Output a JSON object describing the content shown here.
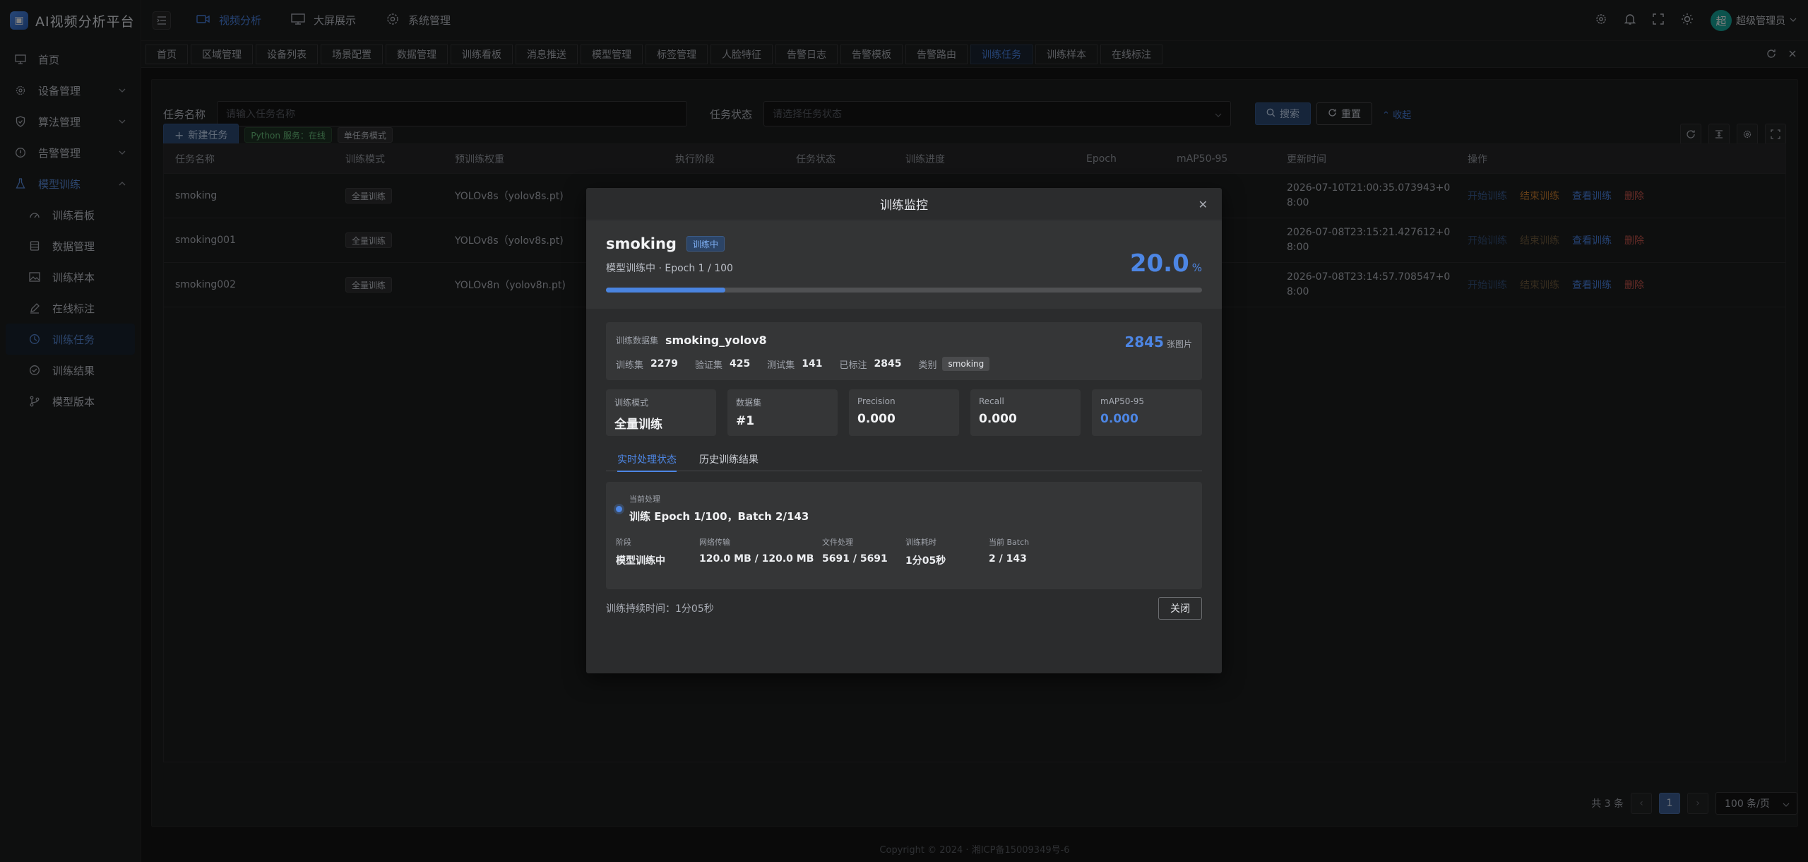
{
  "app": {
    "title": "AI视频分析平台",
    "logo_letter": "AI"
  },
  "sidebar": {
    "items": [
      {
        "label": "首页",
        "icon": "monitor-icon"
      },
      {
        "label": "设备管理",
        "icon": "gear-icon"
      },
      {
        "label": "算法管理",
        "icon": "shield-icon"
      },
      {
        "label": "告警管理",
        "icon": "alert-icon"
      },
      {
        "label": "模型训练",
        "icon": "flask-icon"
      }
    ],
    "subitems": [
      {
        "label": "训练看板",
        "icon": "dashboard-icon"
      },
      {
        "label": "数据管理",
        "icon": "database-icon"
      },
      {
        "label": "训练样本",
        "icon": "image-icon"
      },
      {
        "label": "在线标注",
        "icon": "edit-icon"
      },
      {
        "label": "训练任务",
        "icon": "clock-icon"
      },
      {
        "label": "训练结果",
        "icon": "check-circle-icon"
      },
      {
        "label": "模型版本",
        "icon": "branch-icon"
      }
    ]
  },
  "header": {
    "nav": [
      {
        "label": "视频分析",
        "icon": "camera-icon"
      },
      {
        "label": "大屏展示",
        "icon": "monitor-icon"
      },
      {
        "label": "系统管理",
        "icon": "gear-icon"
      }
    ],
    "user": {
      "avatar": "超",
      "name": "超级管理员"
    }
  },
  "tags": [
    "首页",
    "区域管理",
    "设备列表",
    "场景配置",
    "数据管理",
    "训练看板",
    "消息推送",
    "模型管理",
    "标签管理",
    "人脸特征",
    "告警日志",
    "告警模板",
    "告警路由",
    "训练任务",
    "训练样本",
    "在线标注"
  ],
  "search": {
    "task_name_label": "任务名称",
    "task_name_placeholder": "请输入任务名称",
    "task_status_label": "任务状态",
    "task_status_placeholder": "请选择任务状态",
    "search_btn": "搜索",
    "reset_btn": "重置",
    "collapse": "收起"
  },
  "toolbar": {
    "new_task": "新建任务",
    "python_status": "Python 服务：在线",
    "single_mode": "单任务模式"
  },
  "table": {
    "headers": [
      "任务名称",
      "训练模式",
      "预训练权重",
      "执行阶段",
      "任务状态",
      "训练进度",
      "Epoch",
      "mAP50-95",
      "更新时间",
      "操作"
    ],
    "rows": [
      {
        "name": "smoking",
        "mode": "全量训练",
        "weight": "YOLOv8s（yolov8s.pt)",
        "time1": "2026-07-10T21:00:35.073943+0",
        "time2": "8:00",
        "ops": [
          "开始训练",
          "结束训练",
          "查看训练",
          "删除"
        ]
      },
      {
        "name": "smoking001",
        "mode": "全量训练",
        "weight": "YOLOv8s（yolov8s.pt)",
        "time1": "2026-07-08T23:15:21.427612+0",
        "time2": "8:00",
        "ops": [
          "开始训练",
          "结束训练",
          "查看训练",
          "删除"
        ]
      },
      {
        "name": "smoking002",
        "mode": "全量训练",
        "weight": "YOLOv8n（yolov8n.pt)",
        "time1": "2026-07-08T23:14:57.708547+0",
        "time2": "8:00",
        "ops": [
          "开始训练",
          "结束训练",
          "查看训练",
          "删除"
        ]
      }
    ]
  },
  "pager": {
    "total": "共 3 条",
    "current": "1",
    "size": "100 条/页"
  },
  "footer": "Copyright © 2024 · 湘ICP备15009349号-6",
  "dialog": {
    "title": "训练监控",
    "task_name": "smoking",
    "status": "训练中",
    "subtitle": "模型训练中 · Epoch 1 / 100",
    "percent": "20.0",
    "percent_unit": "%",
    "progress": 0.2,
    "dataset": {
      "label": "训练数据集",
      "name": "smoking_yolov8",
      "count": "2845",
      "count_unit": "张图片",
      "train_label": "训练集",
      "train": "2279",
      "val_label": "验证集",
      "val": "425",
      "test_label": "测试集",
      "test": "141",
      "labeled_label": "已标注",
      "labeled": "2845",
      "class_label": "类别",
      "class": "smoking"
    },
    "metrics": [
      {
        "label": "训练模式",
        "value": "全量训练"
      },
      {
        "label": "数据集",
        "value": "#1"
      },
      {
        "label": "Precision",
        "value": "0.000"
      },
      {
        "label": "Recall",
        "value": "0.000"
      },
      {
        "label": "mAP50-95",
        "value": "0.000"
      }
    ],
    "tabs": [
      "实时处理状态",
      "历史训练结果"
    ],
    "process": {
      "current_label": "当前处理",
      "current": "训练 Epoch 1/100，Batch 2/143",
      "fields": [
        {
          "label": "阶段",
          "value": "模型训练中"
        },
        {
          "label": "网络传输",
          "value": "120.0 MB / 120.0 MB"
        },
        {
          "label": "文件处理",
          "value": "5691 / 5691"
        },
        {
          "label": "训练耗时",
          "value": "1分05秒"
        },
        {
          "label": "当前 Batch",
          "value": "2 / 143"
        }
      ]
    },
    "duration": "训练持续时间：1分05秒",
    "close": "关闭"
  }
}
